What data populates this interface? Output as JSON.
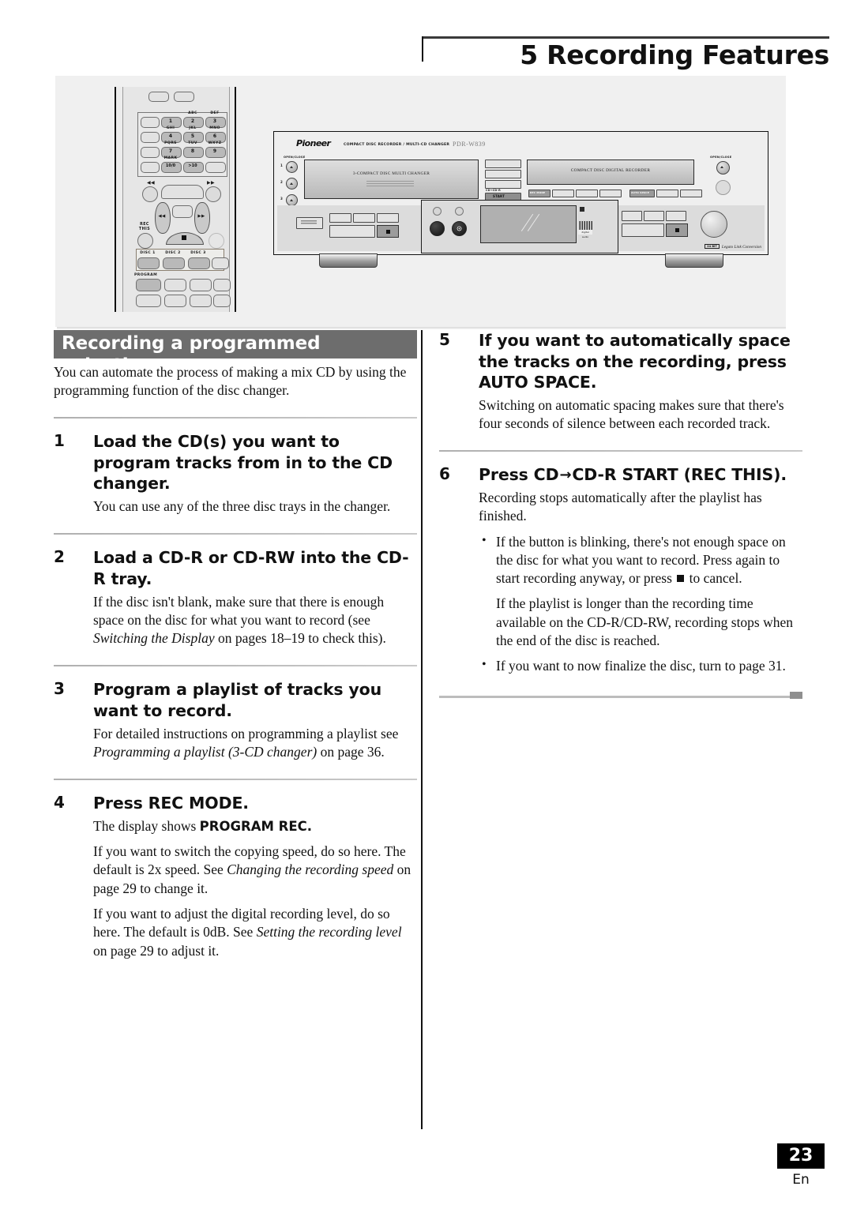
{
  "header": {
    "chapter_title": "5 Recording Features"
  },
  "illustration": {
    "remote": {
      "keys": [
        {
          "label": "1",
          "hint": ""
        },
        {
          "label": "2",
          "hint": "ABC"
        },
        {
          "label": "3",
          "hint": "DEF"
        },
        {
          "label": "4",
          "hint": "GHI"
        },
        {
          "label": "5",
          "hint": "JKL"
        },
        {
          "label": "6",
          "hint": "MNO"
        },
        {
          "label": "7",
          "hint": "PQRS"
        },
        {
          "label": "8",
          "hint": "TUV"
        },
        {
          "label": "9",
          "hint": "WXYZ"
        },
        {
          "label": "10/0",
          "hint": "MARK"
        },
        {
          "label": ">10",
          "hint": ""
        }
      ],
      "rec_this_label": "REC\nTHIS",
      "rec_this_line1": "REC",
      "rec_this_line2": "THIS",
      "disc_buttons": [
        "DISC 1",
        "DISC 2",
        "DISC 3"
      ],
      "program_label": "PROGRAM",
      "skip_back": "◀◀",
      "skip_fwd": "▶▶"
    },
    "deck": {
      "brand": "Pioneer",
      "brand_sub": "COMPACT DISC RECORDER / MULTI-CD CHANGER",
      "model": "PDR-W839",
      "open_close_left": "OPEN/CLOSE",
      "open_close_right": "OPEN/CLOSE",
      "tray_numbers": [
        "1",
        "2",
        "3"
      ],
      "changer_tray_label": "3-COMPACT DISC MULTI CHANGER",
      "recorder_tray_label": "COMPACT DISC DIGITAL RECORDER",
      "cd_to_cdr_label": "CD→CD-R",
      "start_label": "START",
      "rec_this_label": "REC THIS",
      "rec_mode_label": "REC MODE",
      "auto_space_label": "AUTO SPACE",
      "cd_logo_text": "digital audio",
      "legato_badge": "24 BIT",
      "legato_text": "Legato Link Conversion"
    }
  },
  "left_column": {
    "section_title": "Recording a programmed selection",
    "intro": "You can automate the process of making a mix CD by using the programming function of the disc changer.",
    "steps": [
      {
        "num": "1",
        "heading": "Load the CD(s) you want to program tracks from in to the CD changer.",
        "body1": "You can use any of the three disc trays in the changer."
      },
      {
        "num": "2",
        "heading": "Load a CD-R or CD-RW into the CD-R tray.",
        "body1_a": "If the disc isn't blank, make sure that there is enough space on the disc for what you want to record (see ",
        "body1_i": "Switching the Display",
        "body1_b": " on pages 18–19 to check this)."
      },
      {
        "num": "3",
        "heading": "Program a playlist of tracks you want to record.",
        "body1_a": "For detailed instructions on programming a playlist see ",
        "body1_i": "Programming a playlist (3-CD changer)",
        "body1_b": " on page 36."
      },
      {
        "num": "4",
        "heading": "Press REC MODE.",
        "body1_a": "The display shows ",
        "body1_strong": "PROGRAM REC.",
        "body2_a": "If you want to switch the copying speed, do so here. The default is 2x speed. See ",
        "body2_i": "Changing the recording speed",
        "body2_b": " on page 29 to change it.",
        "body3_a": "If you want to adjust the digital recording level, do so here. The default is 0dB. See ",
        "body3_i": "Setting the recording level",
        "body3_b": " on page 29 to adjust it."
      }
    ]
  },
  "right_column": {
    "steps": [
      {
        "num": "5",
        "heading": "If you want to automatically space the tracks on the recording, press AUTO SPACE.",
        "body1": "Switching on automatic spacing makes sure that there's four seconds of silence between each recorded track."
      },
      {
        "num": "6",
        "heading_a": "Press CD",
        "heading_arrow": "→",
        "heading_b": "CD-R START (REC THIS).",
        "body1": "Recording stops automatically after the playlist has finished.",
        "bullet1_a": "If the button is blinking, there's not enough space on the disc for what you want to record. Press again to start recording anyway, or press ",
        "bullet1_b": " to cancel.",
        "body2": "If the playlist is longer than the recording time available on the CD-R/CD-RW, recording stops when the end of the disc is reached.",
        "bullet2": "If you want to now finalize the disc, turn to page 31."
      }
    ]
  },
  "footer": {
    "page_number": "23",
    "language": "En"
  }
}
